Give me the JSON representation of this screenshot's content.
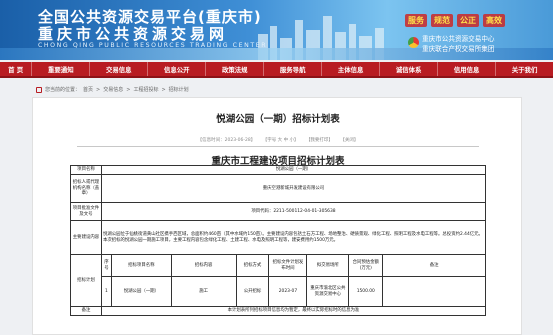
{
  "header": {
    "title_line1": "全国公共资源交易平台(重庆市)",
    "title_line2": "重庆市公共资源交易网",
    "subtitle": "CHONG QING PUBLIC RESOURCES TRADING CENTER",
    "slogans": [
      "服务",
      "规范",
      "公正",
      "高效"
    ],
    "org_line1": "重庆市公共资源交易中心",
    "org_line2": "重庆联合产权交易所集团"
  },
  "nav": {
    "items": [
      "首 页",
      "重要通知",
      "交易信息",
      "信息公开",
      "政策法规",
      "服务导航",
      "主体信息",
      "诚信体系",
      "信用信息",
      "关于我们"
    ]
  },
  "breadcrumb": {
    "prefix": "您当前的位置：",
    "items": [
      "首页",
      "交易信息",
      "工程招投标",
      "招标计划"
    ],
    "sep": ">"
  },
  "article": {
    "title": "悦湖公园（一期）招标计划表",
    "meta_date": "【信息时间：2023-06-28】",
    "meta_font": "【字号 大 中 小】",
    "meta_print": "【我要打印】",
    "meta_close": "【关闭】",
    "table_title": "重庆市工程建设项目招标计划表"
  },
  "plan_table": {
    "project_name_label": "项目名称",
    "project_name": "悦湖公园（一期）",
    "tenderer_label": "招标人或代理机构名称（盖章）",
    "tenderer": "重庆空港新城开发建设有限公司",
    "approval_label": "项目批准文件及文号",
    "approval": "项目代码：2211-500112-04-01-305638",
    "content_label": "主要建设内容",
    "content": "悦湖公园位于仙桃街道黄山社区携手西区域，总面积约460亩（其中水域约150亩）。主要建设内容包括土石方工程、场地整治、硬质景观、绿化工程、照明工程及水电工程等。总投资约2.44亿元。本次招标的悦湖公园一期施工项目，主要工程内容包含绿化工程、土建工程、水电及照明工程等，建安费用约1500万元。",
    "plan_label": "招标计划",
    "columns": [
      "序号",
      "招标项目名称",
      "招标内容",
      "招标方式",
      "招标文件计划发布时间",
      "拟交易场所",
      "合同预估金额(万元)",
      "备注"
    ],
    "rows": [
      {
        "no": "1",
        "name": "悦湖公园（一期）",
        "content": "施工",
        "method": "公开招标",
        "date": "2023-07",
        "venue": "重庆市渝北区公共资源交易中心",
        "amount": "1500.00",
        "note": ""
      }
    ],
    "remark_label": "备注",
    "remark": "本计划表所列招标项目信息均为暂定，最终以实际招标时的信息为准"
  },
  "colors": {
    "nav_red": "#b81c22",
    "banner_blue": "#1a5fa8"
  }
}
